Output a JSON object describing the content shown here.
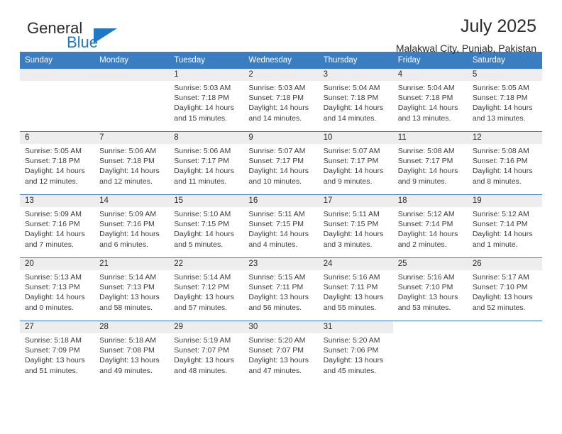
{
  "brand": {
    "word_one": "General",
    "word_two": "Blue",
    "accent_color": "#1f78c1"
  },
  "header": {
    "title": "July 2025",
    "subtitle": "Malakwal City, Punjab, Pakistan"
  },
  "theme": {
    "header_row_bg": "#3a7dc0",
    "daynum_band_bg": "#ededed",
    "text_color": "#2b2b2b"
  },
  "calendar": {
    "weekday_headers": [
      "Sunday",
      "Monday",
      "Tuesday",
      "Wednesday",
      "Thursday",
      "Friday",
      "Saturday"
    ],
    "labels": {
      "sunrise_prefix": "Sunrise:",
      "sunset_prefix": "Sunset:",
      "daylight_prefix": "Daylight:"
    },
    "weeks": [
      [
        {
          "day": "",
          "sunrise": "",
          "sunset": "",
          "daylight": ""
        },
        {
          "day": "",
          "sunrise": "",
          "sunset": "",
          "daylight": ""
        },
        {
          "day": "1",
          "sunrise": "Sunrise: 5:03 AM",
          "sunset": "Sunset: 7:18 PM",
          "daylight": "Daylight: 14 hours and 15 minutes."
        },
        {
          "day": "2",
          "sunrise": "Sunrise: 5:03 AM",
          "sunset": "Sunset: 7:18 PM",
          "daylight": "Daylight: 14 hours and 14 minutes."
        },
        {
          "day": "3",
          "sunrise": "Sunrise: 5:04 AM",
          "sunset": "Sunset: 7:18 PM",
          "daylight": "Daylight: 14 hours and 14 minutes."
        },
        {
          "day": "4",
          "sunrise": "Sunrise: 5:04 AM",
          "sunset": "Sunset: 7:18 PM",
          "daylight": "Daylight: 14 hours and 13 minutes."
        },
        {
          "day": "5",
          "sunrise": "Sunrise: 5:05 AM",
          "sunset": "Sunset: 7:18 PM",
          "daylight": "Daylight: 14 hours and 13 minutes."
        }
      ],
      [
        {
          "day": "6",
          "sunrise": "Sunrise: 5:05 AM",
          "sunset": "Sunset: 7:18 PM",
          "daylight": "Daylight: 14 hours and 12 minutes."
        },
        {
          "day": "7",
          "sunrise": "Sunrise: 5:06 AM",
          "sunset": "Sunset: 7:18 PM",
          "daylight": "Daylight: 14 hours and 12 minutes."
        },
        {
          "day": "8",
          "sunrise": "Sunrise: 5:06 AM",
          "sunset": "Sunset: 7:17 PM",
          "daylight": "Daylight: 14 hours and 11 minutes."
        },
        {
          "day": "9",
          "sunrise": "Sunrise: 5:07 AM",
          "sunset": "Sunset: 7:17 PM",
          "daylight": "Daylight: 14 hours and 10 minutes."
        },
        {
          "day": "10",
          "sunrise": "Sunrise: 5:07 AM",
          "sunset": "Sunset: 7:17 PM",
          "daylight": "Daylight: 14 hours and 9 minutes."
        },
        {
          "day": "11",
          "sunrise": "Sunrise: 5:08 AM",
          "sunset": "Sunset: 7:17 PM",
          "daylight": "Daylight: 14 hours and 9 minutes."
        },
        {
          "day": "12",
          "sunrise": "Sunrise: 5:08 AM",
          "sunset": "Sunset: 7:16 PM",
          "daylight": "Daylight: 14 hours and 8 minutes."
        }
      ],
      [
        {
          "day": "13",
          "sunrise": "Sunrise: 5:09 AM",
          "sunset": "Sunset: 7:16 PM",
          "daylight": "Daylight: 14 hours and 7 minutes."
        },
        {
          "day": "14",
          "sunrise": "Sunrise: 5:09 AM",
          "sunset": "Sunset: 7:16 PM",
          "daylight": "Daylight: 14 hours and 6 minutes."
        },
        {
          "day": "15",
          "sunrise": "Sunrise: 5:10 AM",
          "sunset": "Sunset: 7:15 PM",
          "daylight": "Daylight: 14 hours and 5 minutes."
        },
        {
          "day": "16",
          "sunrise": "Sunrise: 5:11 AM",
          "sunset": "Sunset: 7:15 PM",
          "daylight": "Daylight: 14 hours and 4 minutes."
        },
        {
          "day": "17",
          "sunrise": "Sunrise: 5:11 AM",
          "sunset": "Sunset: 7:15 PM",
          "daylight": "Daylight: 14 hours and 3 minutes."
        },
        {
          "day": "18",
          "sunrise": "Sunrise: 5:12 AM",
          "sunset": "Sunset: 7:14 PM",
          "daylight": "Daylight: 14 hours and 2 minutes."
        },
        {
          "day": "19",
          "sunrise": "Sunrise: 5:12 AM",
          "sunset": "Sunset: 7:14 PM",
          "daylight": "Daylight: 14 hours and 1 minute."
        }
      ],
      [
        {
          "day": "20",
          "sunrise": "Sunrise: 5:13 AM",
          "sunset": "Sunset: 7:13 PM",
          "daylight": "Daylight: 14 hours and 0 minutes."
        },
        {
          "day": "21",
          "sunrise": "Sunrise: 5:14 AM",
          "sunset": "Sunset: 7:13 PM",
          "daylight": "Daylight: 13 hours and 58 minutes."
        },
        {
          "day": "22",
          "sunrise": "Sunrise: 5:14 AM",
          "sunset": "Sunset: 7:12 PM",
          "daylight": "Daylight: 13 hours and 57 minutes."
        },
        {
          "day": "23",
          "sunrise": "Sunrise: 5:15 AM",
          "sunset": "Sunset: 7:11 PM",
          "daylight": "Daylight: 13 hours and 56 minutes."
        },
        {
          "day": "24",
          "sunrise": "Sunrise: 5:16 AM",
          "sunset": "Sunset: 7:11 PM",
          "daylight": "Daylight: 13 hours and 55 minutes."
        },
        {
          "day": "25",
          "sunrise": "Sunrise: 5:16 AM",
          "sunset": "Sunset: 7:10 PM",
          "daylight": "Daylight: 13 hours and 53 minutes."
        },
        {
          "day": "26",
          "sunrise": "Sunrise: 5:17 AM",
          "sunset": "Sunset: 7:10 PM",
          "daylight": "Daylight: 13 hours and 52 minutes."
        }
      ],
      [
        {
          "day": "27",
          "sunrise": "Sunrise: 5:18 AM",
          "sunset": "Sunset: 7:09 PM",
          "daylight": "Daylight: 13 hours and 51 minutes."
        },
        {
          "day": "28",
          "sunrise": "Sunrise: 5:18 AM",
          "sunset": "Sunset: 7:08 PM",
          "daylight": "Daylight: 13 hours and 49 minutes."
        },
        {
          "day": "29",
          "sunrise": "Sunrise: 5:19 AM",
          "sunset": "Sunset: 7:07 PM",
          "daylight": "Daylight: 13 hours and 48 minutes."
        },
        {
          "day": "30",
          "sunrise": "Sunrise: 5:20 AM",
          "sunset": "Sunset: 7:07 PM",
          "daylight": "Daylight: 13 hours and 47 minutes."
        },
        {
          "day": "31",
          "sunrise": "Sunrise: 5:20 AM",
          "sunset": "Sunset: 7:06 PM",
          "daylight": "Daylight: 13 hours and 45 minutes."
        },
        {
          "day": "",
          "sunrise": "",
          "sunset": "",
          "daylight": ""
        },
        {
          "day": "",
          "sunrise": "",
          "sunset": "",
          "daylight": ""
        }
      ]
    ]
  }
}
